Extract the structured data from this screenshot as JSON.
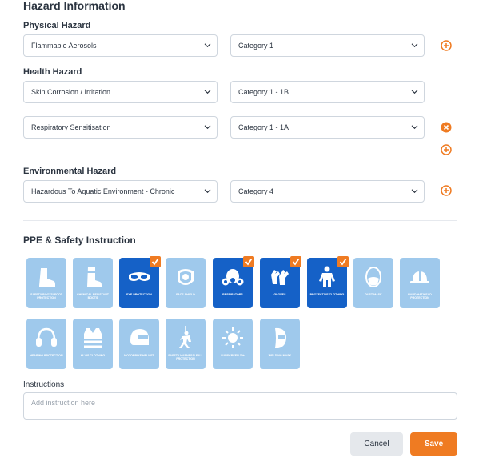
{
  "form": {
    "title": "Hazard Information",
    "physical_label": "Physical Hazard",
    "health_label": "Health Hazard",
    "environmental_label": "Environmental Hazard",
    "rows": [
      {
        "hazard": "Flammable Aerosols",
        "category": "Category 1",
        "action": "add-icon"
      },
      {
        "hazard": "Skin Corrosion / Irritation",
        "category": "Category 1 - 1B",
        "action": ""
      },
      {
        "hazard": "Respiratory Sensitisation",
        "category": "Category 1 - 1A",
        "action": "remove-icon"
      },
      {
        "hazard": "Hazardous To Aquatic Environment - Chronic",
        "category": "Category 4",
        "action": "add-icon"
      }
    ]
  },
  "ppe": {
    "title": "PPE & Safety Instruction",
    "items": [
      {
        "label": "Safety Boots/ Foot Protection",
        "icon": "boot-icon",
        "selected": false
      },
      {
        "label": "Chemical Resistant Boots",
        "icon": "chemical-boot-icon",
        "selected": false
      },
      {
        "label": "Eye Protection",
        "icon": "goggles-icon",
        "selected": true
      },
      {
        "label": "Face Shield",
        "icon": "face-shield-icon",
        "selected": false
      },
      {
        "label": "Respirators",
        "icon": "respirator-icon",
        "selected": true
      },
      {
        "label": "Gloves",
        "icon": "gloves-icon",
        "selected": true
      },
      {
        "label": "Protective Clothing",
        "icon": "coverall-icon",
        "selected": true
      },
      {
        "label": "Dust Mask",
        "icon": "dust-mask-icon",
        "selected": false
      },
      {
        "label": "Hard Hat/Head Protection",
        "icon": "hard-hat-icon",
        "selected": false
      },
      {
        "label": "Hearing Protection",
        "icon": "ear-muffs-icon",
        "selected": false
      },
      {
        "label": "Hi-Vis Clothing",
        "icon": "hi-vis-vest-icon",
        "selected": false
      },
      {
        "label": "Motorbike Helmet",
        "icon": "motorbike-helmet-icon",
        "selected": false
      },
      {
        "label": "Safety Harness/ Fall Protection",
        "icon": "harness-icon",
        "selected": false
      },
      {
        "label": "Sunscreen 30+",
        "icon": "sun-icon",
        "selected": false
      },
      {
        "label": "Welding Mask",
        "icon": "welding-mask-icon",
        "selected": false
      }
    ]
  },
  "instructions": {
    "label": "Instructions",
    "placeholder": "Add instruction here",
    "value": ""
  },
  "actions": {
    "cancel_label": "Cancel",
    "save_label": "Save"
  },
  "colors": {
    "accent": "#ef7b22",
    "tile_default": "#9fc9ec",
    "tile_selected": "#1561c7"
  }
}
